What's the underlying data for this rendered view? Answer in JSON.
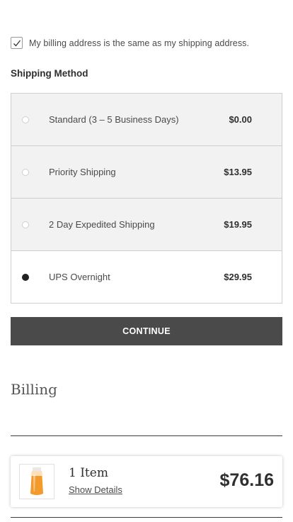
{
  "billing_same_as_shipping": {
    "checked": true,
    "label": "My billing address is the same as my shipping address."
  },
  "shipping": {
    "title": "Shipping Method",
    "options": [
      {
        "name": "Standard (3 – 5 Business Days)",
        "price": "$0.00",
        "selected": false
      },
      {
        "name": "Priority Shipping",
        "price": "$13.95",
        "selected": false
      },
      {
        "name": "2 Day Expedited Shipping",
        "price": "$19.95",
        "selected": false
      },
      {
        "name": "UPS Overnight",
        "price": "$29.95",
        "selected": true
      }
    ]
  },
  "continue_label": "CONTINUE",
  "billing_heading": "Billing",
  "summary": {
    "item_count": "1 Item",
    "show_details": "Show Details",
    "total": "$76.16",
    "thumbnail_icon": "sunscreen-tube-icon"
  }
}
